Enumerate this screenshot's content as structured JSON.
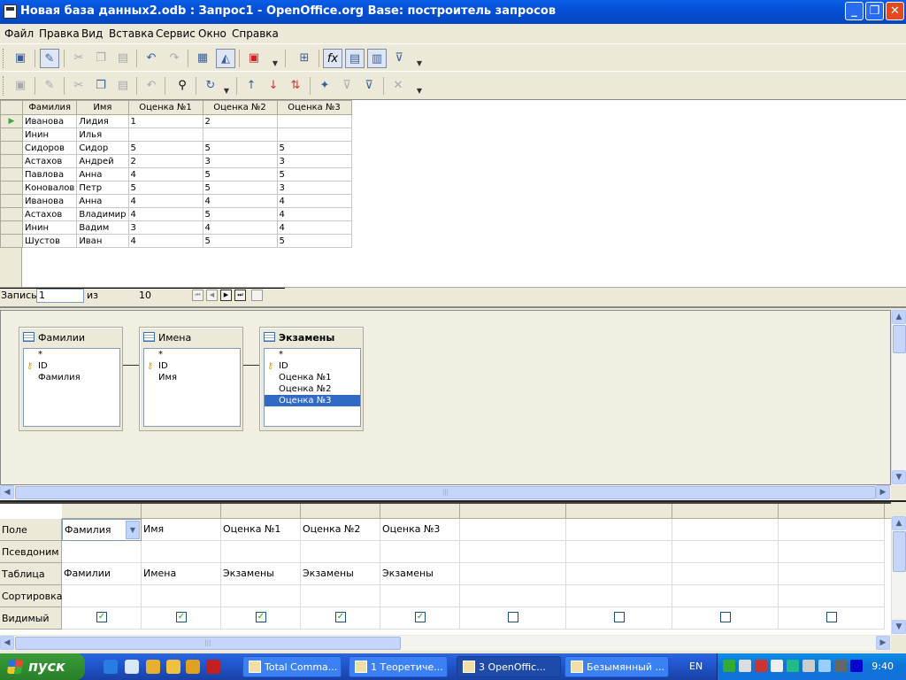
{
  "window": {
    "title": "Новая база данных2.odb : Запрос1 - OpenOffice.org Base: построитель запросов",
    "min": "_",
    "max": "❐",
    "close": "✕"
  },
  "menu": [
    "Файл",
    "Правка",
    "Вид",
    "Вставка",
    "Сервис",
    "Окно",
    "Справка"
  ],
  "result": {
    "columns": [
      "Фамилия",
      "Имя",
      "Оценка №1",
      "Оценка №2",
      "Оценка №3"
    ],
    "rows": [
      [
        "Иванова",
        "Лидия",
        "1",
        "2",
        ""
      ],
      [
        "Инин",
        "Илья",
        "",
        "",
        ""
      ],
      [
        "Сидоров",
        "Сидор",
        "5",
        "5",
        "5"
      ],
      [
        "Астахов",
        "Андрей",
        "2",
        "3",
        "3"
      ],
      [
        "Павлова",
        "Анна",
        "4",
        "5",
        "5"
      ],
      [
        "Коновалов",
        "Петр",
        "5",
        "5",
        "3"
      ],
      [
        "Иванова",
        "Анна",
        "4",
        "4",
        "4"
      ],
      [
        "Астахов",
        "Владимир",
        "4",
        "5",
        "4"
      ],
      [
        "Инин",
        "Вадим",
        "3",
        "4",
        "4"
      ],
      [
        "Шустов",
        "Иван",
        "4",
        "5",
        "5"
      ]
    ],
    "record_label": "Запись",
    "record_value": "1",
    "of_label": "из",
    "total": "10"
  },
  "tables": [
    {
      "name": "Фамилии",
      "fields": [
        {
          "t": "*"
        },
        {
          "t": "ID",
          "key": true
        },
        {
          "t": "Фамилия"
        }
      ]
    },
    {
      "name": "Имена",
      "fields": [
        {
          "t": "*"
        },
        {
          "t": "ID",
          "key": true
        },
        {
          "t": "Имя"
        }
      ]
    },
    {
      "name": "Экзамены",
      "fields": [
        {
          "t": "*"
        },
        {
          "t": "ID",
          "key": true
        },
        {
          "t": "Оценка №1"
        },
        {
          "t": "Оценка №2"
        },
        {
          "t": "Оценка №3",
          "selected": true
        }
      ]
    }
  ],
  "query": {
    "row_labels": [
      "Поле",
      "Псевдоним",
      "Таблица",
      "Сортировка",
      "Видимый"
    ],
    "columns": [
      {
        "field": "Фамилия",
        "table": "Фамилии",
        "visible": true
      },
      {
        "field": "Имя",
        "table": "Имена",
        "visible": true
      },
      {
        "field": "Оценка №1",
        "table": "Экзамены",
        "visible": true
      },
      {
        "field": "Оценка №2",
        "table": "Экзамены",
        "visible": true
      },
      {
        "field": "Оценка №3",
        "table": "Экзамены",
        "visible": true
      },
      {
        "field": "",
        "table": "",
        "visible": false
      },
      {
        "field": "",
        "table": "",
        "visible": false
      },
      {
        "field": "",
        "table": "",
        "visible": false
      },
      {
        "field": "",
        "table": "",
        "visible": false
      }
    ]
  },
  "taskbar": {
    "start": "пуск",
    "tasks": [
      {
        "label": "Total Comma...",
        "active": false
      },
      {
        "label": "1 Теоретиче...",
        "active": false
      },
      {
        "label": "3 OpenOffic...",
        "active": true
      },
      {
        "label": "Безымянный ...",
        "active": false
      }
    ],
    "lang": "EN",
    "clock": "9:40"
  },
  "icons": {
    "accent": "#316ac5",
    "titlebar": "#0450d6"
  }
}
